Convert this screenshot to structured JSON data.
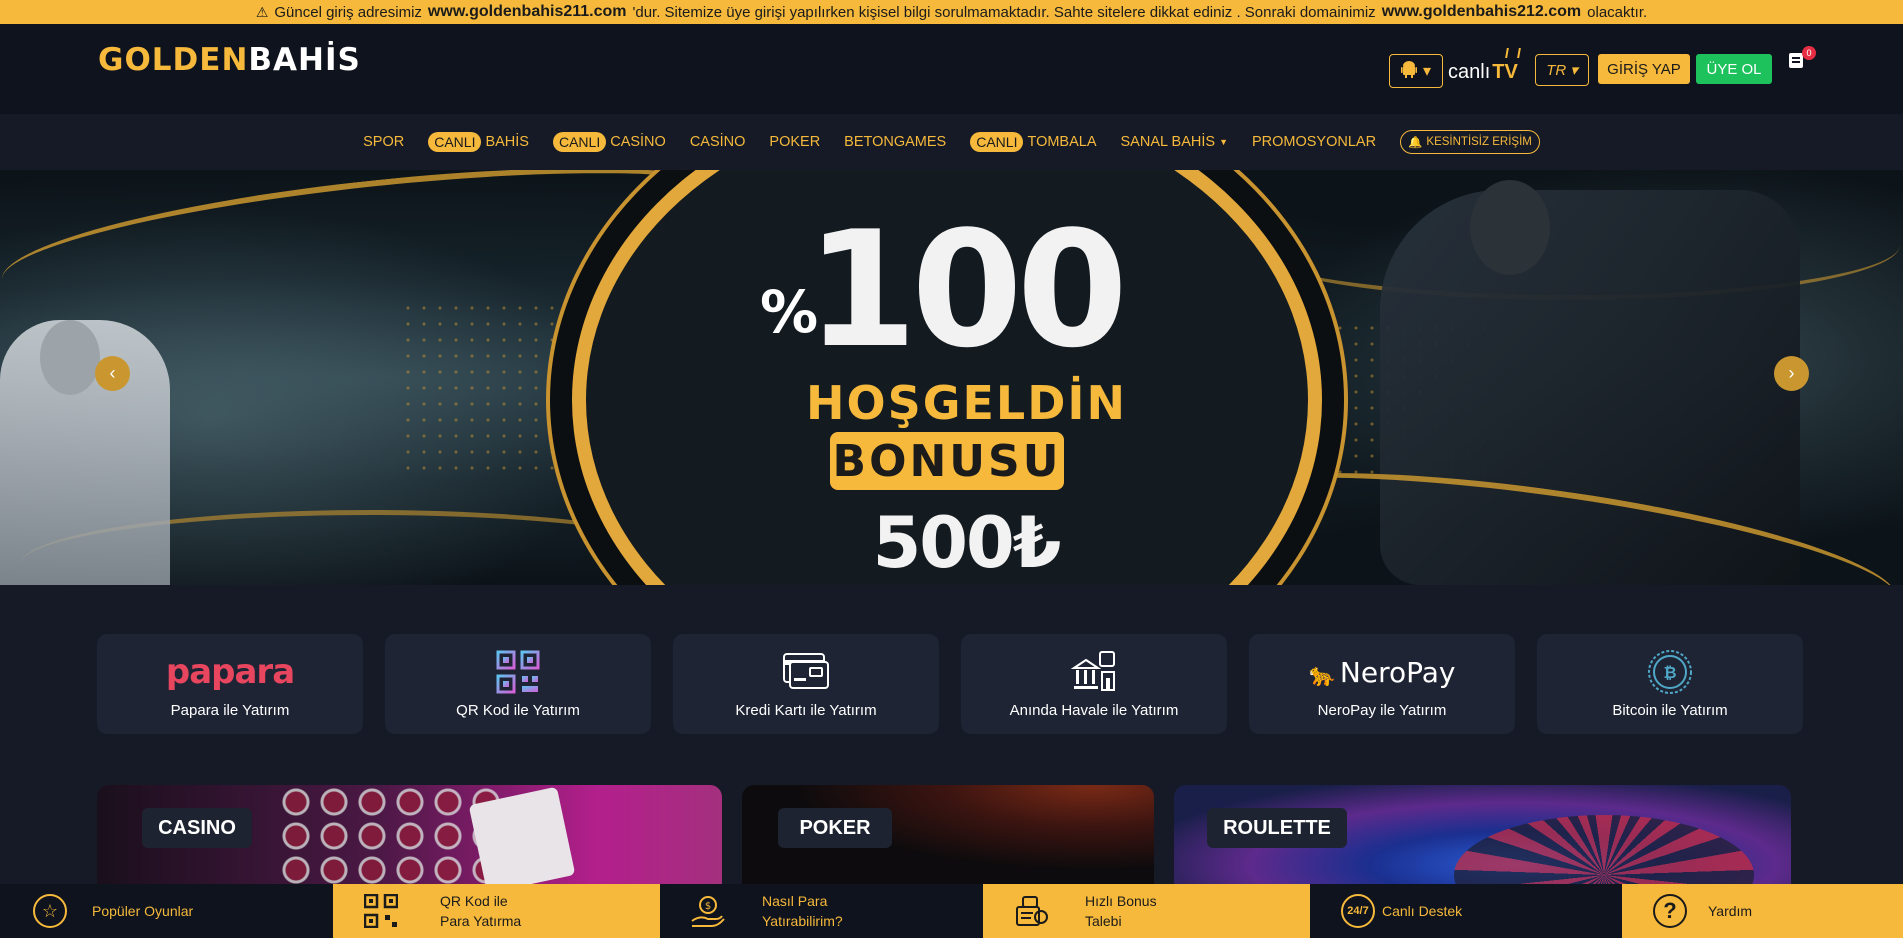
{
  "announcement": {
    "part1": "Güncel giriş adresimiz",
    "domain_current": "www.goldenbahis211.com",
    "part2": "'dur. Sitemize üye girişi yapılırken kişisel bilgi sorulmamaktadır. Sahte sitelere dikkat ediniz . Sonraki domainimiz",
    "domain_next": "www.goldenbahis212.com",
    "part3": "olacaktır."
  },
  "header": {
    "logo_part1": "GOLDEN",
    "logo_part2": "BAHİS",
    "canli_tv_prefix": "canlı",
    "canli_tv_suffix": "TV",
    "language": "TR",
    "login_label": "GİRİŞ YAP",
    "signup_label": "ÜYE OL",
    "notification_count": "0"
  },
  "nav": {
    "items": [
      {
        "label": "SPOR"
      },
      {
        "pill": "CANLI",
        "label": "BAHİS"
      },
      {
        "pill": "CANLI",
        "label": "CASİNO"
      },
      {
        "label": "CASİNO"
      },
      {
        "label": "POKER"
      },
      {
        "label": "BETONGAMES"
      },
      {
        "pill": "CANLI",
        "label": "TOMBALA"
      },
      {
        "label": "SANAL BAHİS"
      },
      {
        "label": "PROMOSYONLAR"
      }
    ],
    "kesintisiz": "KESİNTİSİZ ERİŞİM"
  },
  "hero": {
    "percent_sign": "%",
    "percent_value": "100",
    "line1": "HOŞGELDİN",
    "line2": "BONUSU",
    "amount": "500₺"
  },
  "payments": [
    {
      "logo_text": "papara",
      "label": "Papara ile Yatırım"
    },
    {
      "label": "QR Kod ile Yatırım"
    },
    {
      "label": "Kredi Kartı ile Yatırım"
    },
    {
      "label": "Anında Havale ile Yatırım"
    },
    {
      "logo_text": "NeroPay",
      "label": "NeroPay ile Yatırım"
    },
    {
      "label": "Bitcoin ile Yatırım"
    }
  ],
  "tiles": {
    "casino": "CASINO",
    "poker": "POKER",
    "roulette": "ROULETTE"
  },
  "bottom_bar": {
    "populer": "Popüler Oyunlar",
    "qr_line1": "QR Kod ile",
    "qr_line2": "Para Yatırma",
    "nasil_line1": "Nasıl Para",
    "nasil_line2": "Yatırabilirim?",
    "hizli_line1": "Hızlı Bonus",
    "hizli_line2": "Talebi",
    "canli_destek": "Canlı Destek",
    "canli_destek_icon_text": "24/7",
    "yardim": "Yardım"
  },
  "colors": {
    "accent_gold": "#f6b93b",
    "signup_green": "#1ec25c",
    "background": "#151a26",
    "papara_pink": "#e8455e"
  }
}
